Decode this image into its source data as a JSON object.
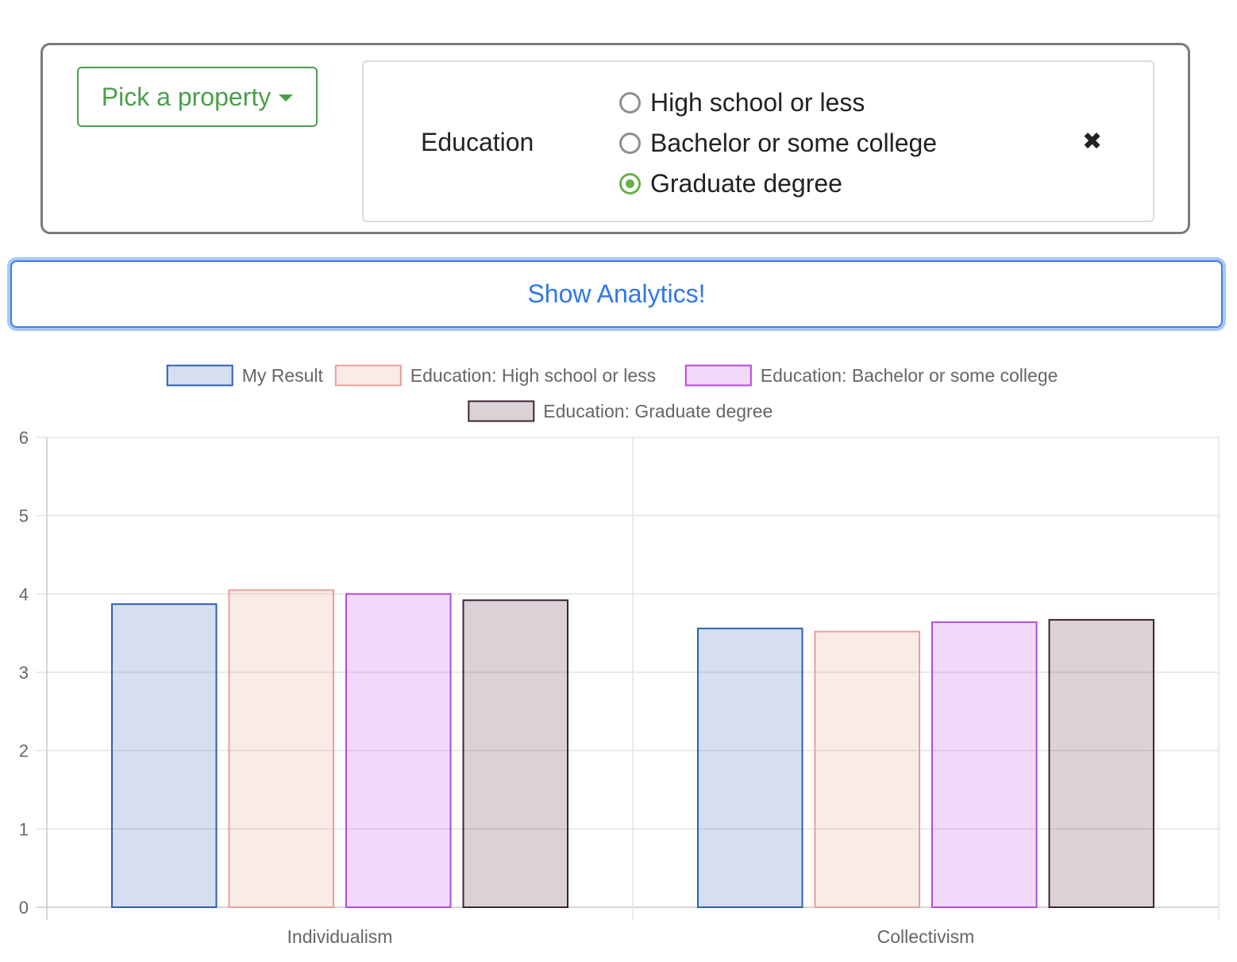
{
  "filter": {
    "pick_label": "Pick a property",
    "property_name": "Education",
    "options": [
      {
        "label": "High school or less",
        "checked": false
      },
      {
        "label": "Bachelor or some college",
        "checked": false
      },
      {
        "label": "Graduate degree",
        "checked": true
      }
    ],
    "remove_symbol": "✖"
  },
  "analytics_button": "Show Analytics!",
  "colors": {
    "accent_green": "#4aa04a",
    "radio_selected": "#6ab04c",
    "button_blue": "#2f78e8"
  },
  "chart_data": {
    "type": "bar",
    "categories": [
      "Individualism",
      "Collectivism"
    ],
    "series": [
      {
        "name": "My Result",
        "values": [
          3.87,
          3.56
        ],
        "fill": "rgba(47,95,175,0.2)",
        "stroke": "#2e5fae"
      },
      {
        "name": "Education: High school or less",
        "values": [
          4.05,
          3.52
        ],
        "fill": "rgba(232,150,140,0.2)",
        "stroke": "#e8a198"
      },
      {
        "name": "Education: Bachelor or some college",
        "values": [
          4.0,
          3.64
        ],
        "fill": "rgba(190,80,230,0.22)",
        "stroke": "#b44ad8"
      },
      {
        "name": "Education: Graduate degree",
        "values": [
          3.92,
          3.67
        ],
        "fill": "rgba(75,30,55,0.2)",
        "stroke": "#3e2433"
      }
    ],
    "ylim": [
      0,
      6
    ],
    "yticks": [
      "0",
      "1",
      "2",
      "3",
      "4",
      "5",
      "6"
    ],
    "grid": true,
    "legend_position": "top"
  }
}
